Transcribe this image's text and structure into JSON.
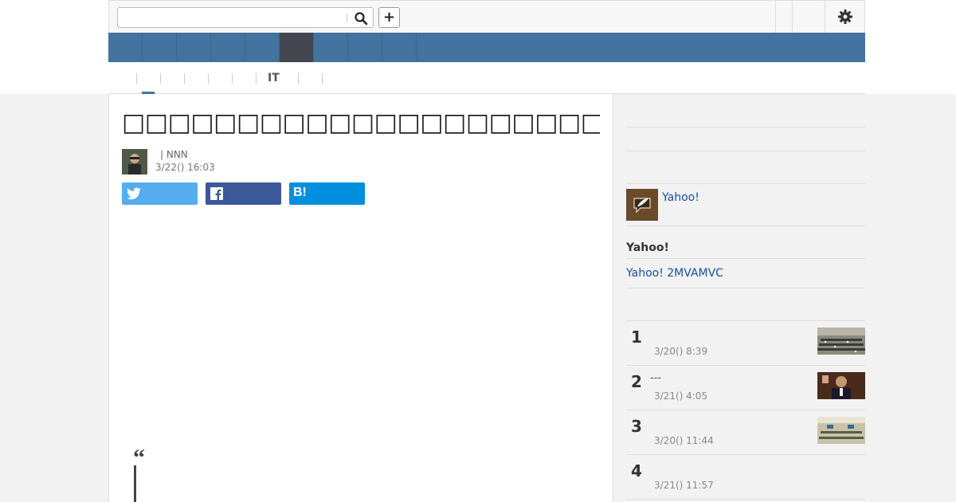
{
  "header": {
    "search_value": "",
    "search_placeholder": "",
    "add_label": "+",
    "search_icon": "search-icon",
    "settings_icon": "gear-icon"
  },
  "category_nav": {
    "items": [
      "",
      "",
      "",
      "",
      "",
      "",
      "",
      "",
      ""
    ],
    "active_index": 5,
    "color": "#43739f",
    "active_color": "#44474f"
  },
  "sub_nav": {
    "items": [
      "",
      "",
      "",
      "",
      "",
      "IT",
      ""
    ],
    "active_index": 0
  },
  "article": {
    "title": "□□□□□□□□□□□□□□□□□□□□□□□□□□□□□□□□□□□□□□□",
    "author": "| NNN",
    "date": "3/22() 16:03",
    "share": {
      "twitter_icon": "twitter-icon",
      "facebook_icon": "facebook-icon",
      "hatena_label": "B!",
      "twitter_color": "#55acee",
      "facebook_color": "#3b5998",
      "hatena_color": "#008fde"
    },
    "quote_mark": "“"
  },
  "sidebar": {
    "yahoo_link": "Yahoo!",
    "section_heading": "Yahoo!",
    "promo_link": "Yahoo! 2MVAMVC",
    "ranking": [
      {
        "rank": "1",
        "title": "",
        "date": "3/20() 8:39"
      },
      {
        "rank": "2",
        "title": "---",
        "date": "3/21() 4:05"
      },
      {
        "rank": "3",
        "title": "",
        "date": "3/20() 11:44"
      },
      {
        "rank": "4",
        "title": "",
        "date": "3/21() 11:57"
      }
    ]
  }
}
